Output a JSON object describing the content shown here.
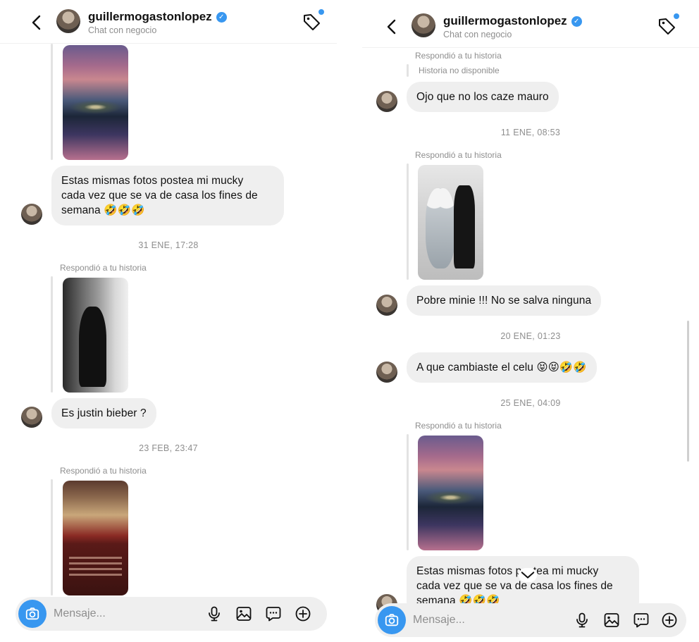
{
  "header": {
    "username": "guillermogastonlopez",
    "subtitle": "Chat con negocio"
  },
  "icons": {
    "back": "chevron-left",
    "verified": "verified-badge",
    "tag": "tag-outline",
    "camera": "camera",
    "mic": "microphone",
    "gallery": "image",
    "sticker": "chat-bubble-dots",
    "plus": "plus-circle"
  },
  "colors": {
    "accent": "#3897f0",
    "bubble": "#efefef",
    "muted": "#8e8e8e"
  },
  "left": {
    "message1": "Estas mismas fotos postea mi mucky\ncada vez que se va de casa los fines de\nsemana 🤣🤣🤣",
    "time1": "31 ENE, 17:28",
    "reply_label1": "Respondió a tu historia",
    "message2": "Es justin bieber ?",
    "time2": "23 FEB, 23:47",
    "reply_label2": "Respondió a tu historia"
  },
  "right": {
    "reply_label1": "Respondió a tu historia",
    "story_unavailable": "Historia no disponible",
    "message1": "Ojo que no los caze mauro",
    "time1": "11 ENE, 08:53",
    "reply_label2": "Respondió a tu historia",
    "message2": "Pobre minie !!! No se salva ninguna",
    "time2": "20 ENE, 01:23",
    "message3": "A que cambiaste el celu  😝😝🤣🤣",
    "time3": "25 ENE, 04:09",
    "reply_label3": "Respondió a tu historia",
    "message4": "Estas mismas fotos postea mi mucky\ncada vez que se va de casa los fines de\nsemana 🤣🤣🤣"
  },
  "composer": {
    "placeholder": "Mensaje..."
  }
}
